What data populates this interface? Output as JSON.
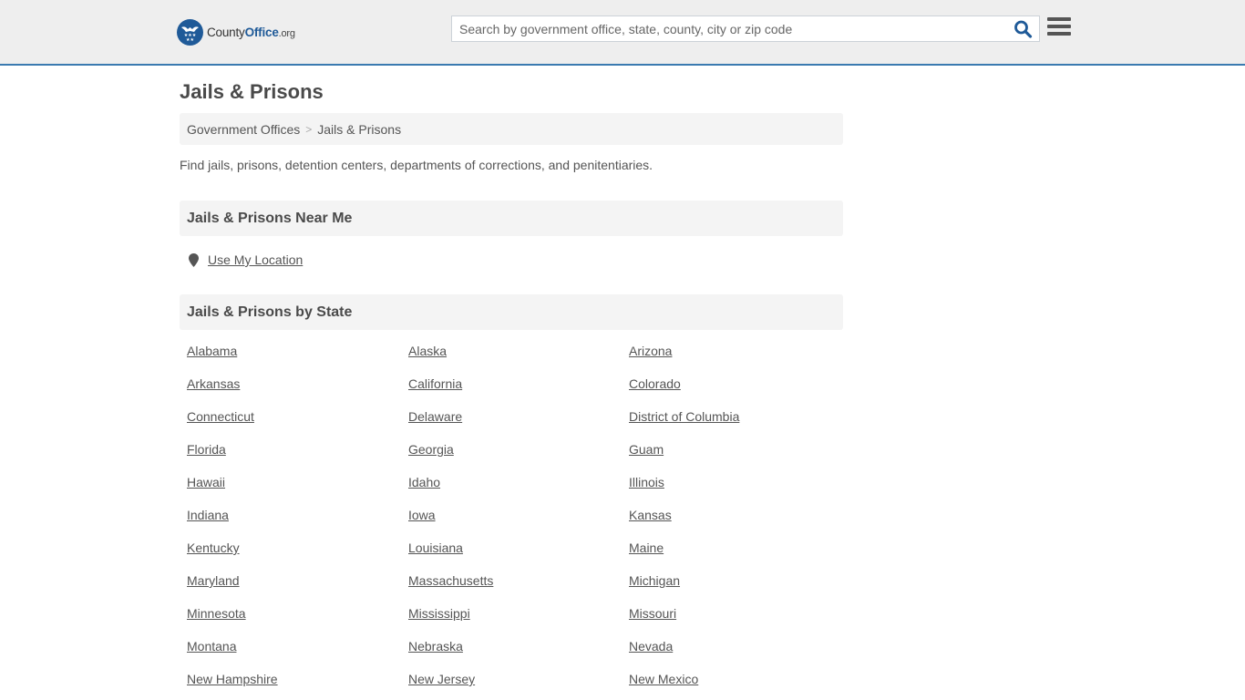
{
  "header": {
    "logo": {
      "name_regular": "County",
      "name_bold": "Office",
      "tld": ".org"
    },
    "search": {
      "placeholder": "Search by government office, state, county, city or zip code",
      "value": ""
    },
    "icons": {
      "search": "search-icon",
      "menu": "hamburger-menu-icon",
      "logo": "eagle-stars-badge-icon"
    },
    "colors": {
      "brand": "#1f5a98",
      "header_border": "#3a7ab0"
    }
  },
  "page": {
    "title": "Jails & Prisons",
    "breadcrumb": [
      {
        "label": "Government Offices"
      },
      {
        "label": "Jails & Prisons"
      }
    ],
    "breadcrumb_separator": ">",
    "intro": "Find jails, prisons, detention centers, departments of corrections, and penitentiaries."
  },
  "near_me": {
    "heading": "Jails & Prisons Near Me",
    "use_location_label": "Use My Location",
    "icon": "map-marker-icon"
  },
  "by_state": {
    "heading": "Jails & Prisons by State",
    "states": [
      "Alabama",
      "Alaska",
      "Arizona",
      "Arkansas",
      "California",
      "Colorado",
      "Connecticut",
      "Delaware",
      "District of Columbia",
      "Florida",
      "Georgia",
      "Guam",
      "Hawaii",
      "Idaho",
      "Illinois",
      "Indiana",
      "Iowa",
      "Kansas",
      "Kentucky",
      "Louisiana",
      "Maine",
      "Maryland",
      "Massachusetts",
      "Michigan",
      "Minnesota",
      "Mississippi",
      "Missouri",
      "Montana",
      "Nebraska",
      "Nevada",
      "New Hampshire",
      "New Jersey",
      "New Mexico"
    ]
  }
}
